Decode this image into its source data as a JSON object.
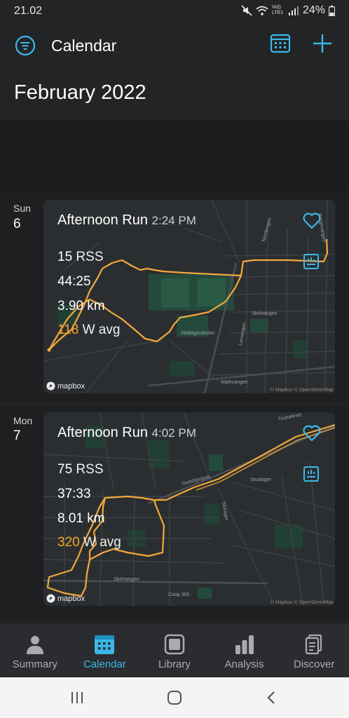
{
  "status_bar": {
    "time": "21.02",
    "network": "Vo)) LTE1",
    "battery": "24%"
  },
  "header": {
    "title": "Calendar",
    "month": "February 2022"
  },
  "days": [
    {
      "weekday": "Sun",
      "date": "6",
      "activity": {
        "title": "Afternoon Run",
        "time": "2:24 PM",
        "rss_value": "15",
        "rss_unit": "RSS",
        "duration": "44:25",
        "distance": "3.90 km",
        "power_value": "118",
        "power_unit": "W avg"
      },
      "map": {
        "logo": "mapbox",
        "attribution": "© Mapbox © OpenStreetMap",
        "streets": [
          "Skelvangen",
          "Heldagerskolen",
          "Markvangen",
          "Nordengen",
          "Bergsvangen",
          "Lervangen"
        ]
      }
    },
    {
      "weekday": "Mon",
      "date": "7",
      "activity": {
        "title": "Afternoon Run",
        "time": "4:02 PM",
        "rss_value": "75",
        "rss_unit": "RSS",
        "duration": "37:33",
        "distance": "8.01 km",
        "power_value": "320",
        "power_unit": "W avg"
      },
      "map": {
        "logo": "mapbox",
        "attribution": "© Mapbox © OpenStreetMap",
        "streets": [
          "Tirsbækvej",
          "Smalager",
          "Storager",
          "Skelvangen",
          "Coop 365",
          "Gudsbjergvej"
        ]
      }
    }
  ],
  "bottom_nav": [
    {
      "label": "Summary",
      "icon": "person-icon",
      "active": false
    },
    {
      "label": "Calendar",
      "icon": "calendar-icon",
      "active": true
    },
    {
      "label": "Library",
      "icon": "library-icon",
      "active": false
    },
    {
      "label": "Analysis",
      "icon": "bar-chart-icon",
      "active": false
    },
    {
      "label": "Discover",
      "icon": "document-icon",
      "active": false
    }
  ],
  "colors": {
    "accent": "#3bb8e8",
    "power": "#f5a623",
    "route": "#f2a93b",
    "background": "#222426"
  }
}
